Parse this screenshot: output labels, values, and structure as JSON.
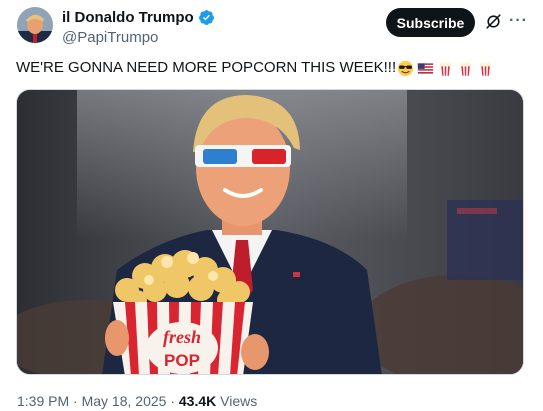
{
  "author": {
    "display_name": "il Donaldo Trumpo",
    "handle": "@PapiTrumpo",
    "verified": true,
    "verified_color": "#1d9bf0"
  },
  "actions": {
    "subscribe_label": "Subscribe",
    "grok_icon": "grok-icon",
    "more_icon": "more-icon"
  },
  "post": {
    "text": "WE'RE GONNA NEED MORE POPCORN THIS WEEK!!!",
    "emojis": [
      "sunglasses-emoji",
      "us-flag-emoji",
      "popcorn-emoji",
      "popcorn-emoji",
      "popcorn-emoji"
    ],
    "image_logo_text": [
      "fresh",
      "POP"
    ]
  },
  "meta": {
    "time": "1:39 PM",
    "date": "May 18, 2025",
    "separator": " · ",
    "views_count": "43.4K",
    "views_label": "Views"
  },
  "colors": {
    "text_primary": "#0f1419",
    "text_secondary": "#536471",
    "button_bg": "#0f1419",
    "border": "#cfd9de"
  }
}
